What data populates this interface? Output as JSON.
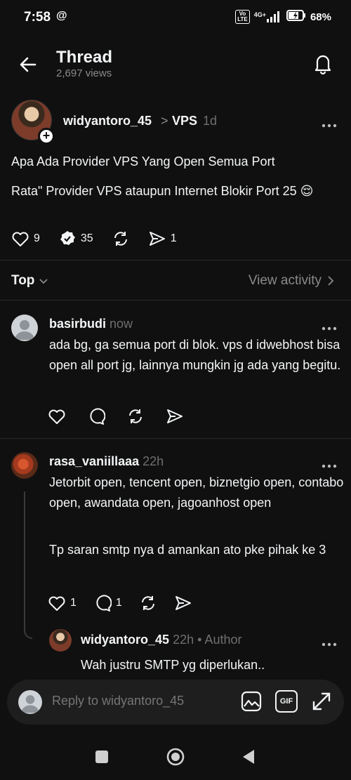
{
  "status": {
    "time": "7:58",
    "threads_glyph": "@",
    "volte": "Vo\nLTE",
    "network": "4G+",
    "battery": "68%"
  },
  "header": {
    "title": "Thread",
    "views": "2,697 views"
  },
  "post": {
    "username": "widyantoro_45",
    "chevron": ">",
    "topic": "VPS",
    "time": "1d",
    "text_title": "Apa Ada Provider VPS Yang Open Semua Port",
    "text_body": "Rata\" Provider VPS ataupun Internet Blokir Port 25 😌",
    "likes": "9",
    "replies": "35",
    "shares": "1"
  },
  "sort": {
    "label": "Top",
    "view_activity": "View activity"
  },
  "replies": [
    {
      "username": "basirbudi",
      "time": "now",
      "text": "ada bg, ga semua port di blok. vps d idwebhost bisa open all port jg, lainnya mungkin jg ada yang begitu."
    },
    {
      "username": "rasa_vaniillaaa",
      "time": "22h",
      "text1": "Jetorbit open, tencent open, biznetgio open, contabo open, awandata open, jagoanhost open",
      "text2": "Tp saran smtp nya d amankan ato pke pihak ke 3",
      "likes": "1",
      "comments": "1"
    },
    {
      "username": "widyantoro_45",
      "time": "22h",
      "author_tag": "• Author",
      "text": "Wah justru SMTP yg diperlukan.."
    }
  ],
  "reply_bar": {
    "placeholder": "Reply to widyantoro_45",
    "gif_label": "GIF"
  },
  "icons": {
    "back": "arrow-left-icon",
    "bell": "bell-icon",
    "heart": "heart-icon",
    "comment": "comment-icon",
    "repost": "repost-icon",
    "share": "share-icon",
    "more": "more-dots-icon",
    "image": "image-icon",
    "gif": "gif-icon",
    "expand": "expand-icon"
  },
  "colors": {
    "background": "#101010",
    "text": "#f3f5f7",
    "muted": "#8a8a8a",
    "divider": "#2a2a2a"
  }
}
